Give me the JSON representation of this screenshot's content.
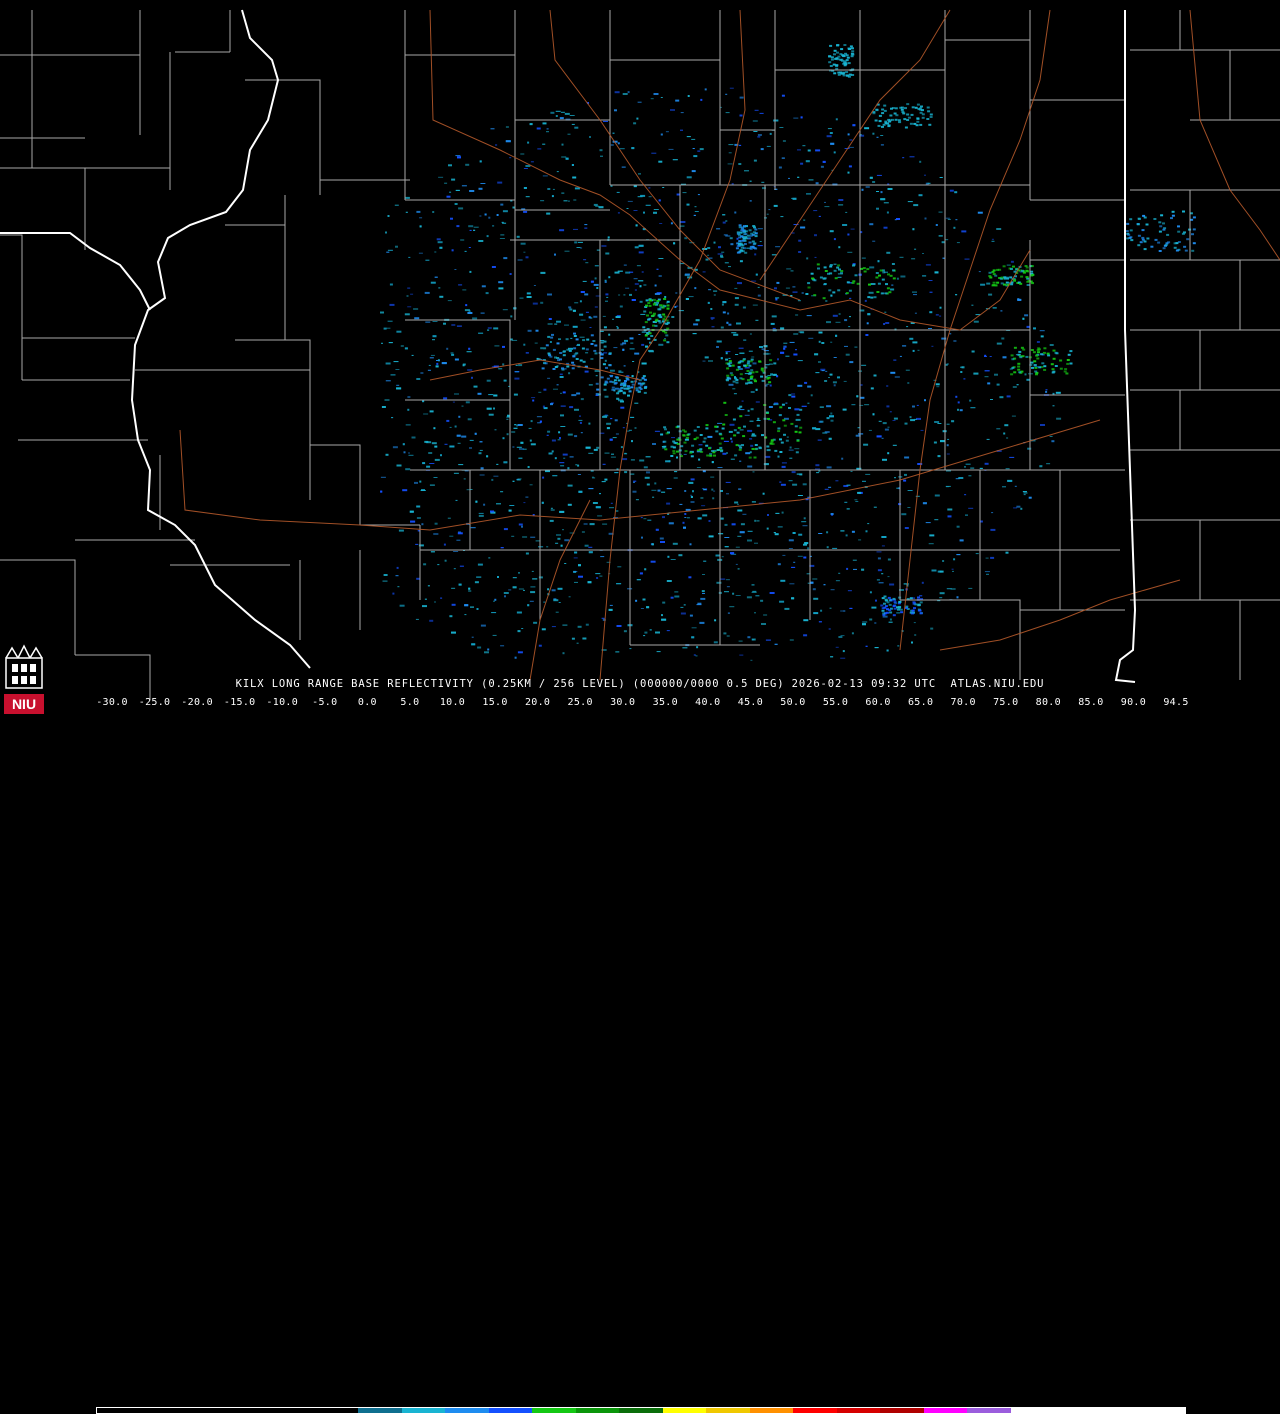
{
  "product": {
    "title": "KILX LONG RANGE BASE REFLECTIVITY (0.25KM / 256 LEVEL) (000000/0000 0.5 DEG) 2026-02-13 09:32 UTC  ATLAS.NIU.EDU"
  },
  "logo": {
    "text": "NIU",
    "color": "#c8102e"
  },
  "map": {
    "radar_site": "KILX",
    "state_border_color": "#ffffff",
    "county_border_color": "#a8a8a8",
    "highway_color": "#b2582a",
    "background": "#000000"
  },
  "legend": {
    "ticks": [
      "-30.0",
      "-25.0",
      "-20.0",
      "-15.0",
      "-10.0",
      "-5.0",
      "0.0",
      "5.0",
      "10.0",
      "15.0",
      "20.0",
      "25.0",
      "30.0",
      "35.0",
      "40.0",
      "45.0",
      "50.0",
      "55.0",
      "60.0",
      "65.0",
      "70.0",
      "75.0",
      "80.0",
      "85.0",
      "90.0",
      "94.5"
    ],
    "colors": [
      "#000000",
      "#000000",
      "#000000",
      "#000000",
      "#000000",
      "#000000",
      "#0f6f8f",
      "#18b4d2",
      "#1e8cf0",
      "#1450ff",
      "#14c814",
      "#0a960a",
      "#0a6e0a",
      "#ffff00",
      "#f0c800",
      "#ff9000",
      "#ff0000",
      "#d60000",
      "#b00000",
      "#ff00ff",
      "#9b5ddd",
      "#ffffff",
      "#ffffff",
      "#ffffff",
      "#ffffff"
    ]
  }
}
